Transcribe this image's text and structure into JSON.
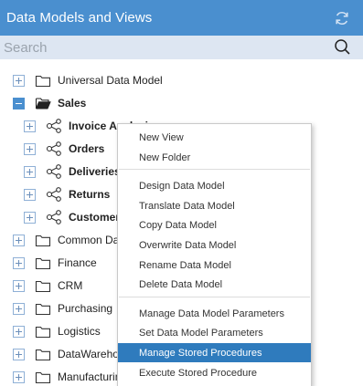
{
  "header": {
    "title": "Data Models and Views",
    "refresh_icon": "refresh-icon"
  },
  "search": {
    "placeholder": "Search",
    "value": "",
    "icon": "search-icon"
  },
  "tree": [
    {
      "label": "Universal Data Model",
      "type": "folder",
      "expander": "plus",
      "bold": false
    },
    {
      "label": "Sales",
      "type": "folder-open",
      "expander": "minus",
      "bold": true
    },
    {
      "label": "Invoice Analysis",
      "type": "model",
      "expander": "plus",
      "bold": true
    },
    {
      "label": "Orders",
      "type": "model",
      "expander": "plus",
      "bold": true
    },
    {
      "label": "Deliveries",
      "type": "model",
      "expander": "plus",
      "bold": true
    },
    {
      "label": "Returns",
      "type": "model",
      "expander": "plus",
      "bold": true
    },
    {
      "label": "Customer Analysis",
      "type": "model",
      "expander": "plus",
      "bold": true
    },
    {
      "label": "Common Data",
      "type": "folder",
      "expander": "plus",
      "bold": false
    },
    {
      "label": "Finance",
      "type": "folder",
      "expander": "plus",
      "bold": false
    },
    {
      "label": "CRM",
      "type": "folder",
      "expander": "plus",
      "bold": false
    },
    {
      "label": "Purchasing",
      "type": "folder",
      "expander": "plus",
      "bold": false
    },
    {
      "label": "Logistics",
      "type": "folder",
      "expander": "plus",
      "bold": false
    },
    {
      "label": "DataWarehouse",
      "type": "folder",
      "expander": "plus",
      "bold": false
    },
    {
      "label": "Manufacturing",
      "type": "folder",
      "expander": "plus",
      "bold": false
    }
  ],
  "context_menu": {
    "items": [
      {
        "label": "New View"
      },
      {
        "label": "New Folder"
      },
      {
        "label": "Design Data Model"
      },
      {
        "label": "Translate Data Model"
      },
      {
        "label": "Copy Data Model"
      },
      {
        "label": "Overwrite Data Model"
      },
      {
        "label": "Rename Data Model"
      },
      {
        "label": "Delete Data Model"
      },
      {
        "label": "Manage Data Model Parameters"
      },
      {
        "label": "Set Data Model Parameters"
      },
      {
        "label": "Manage Stored Procedures",
        "highlighted": true
      },
      {
        "label": "Execute Stored Procedure"
      }
    ]
  },
  "colors": {
    "accent": "#4a8fcf",
    "highlight": "#2f7bbd",
    "search_bg": "#dde6f2"
  }
}
